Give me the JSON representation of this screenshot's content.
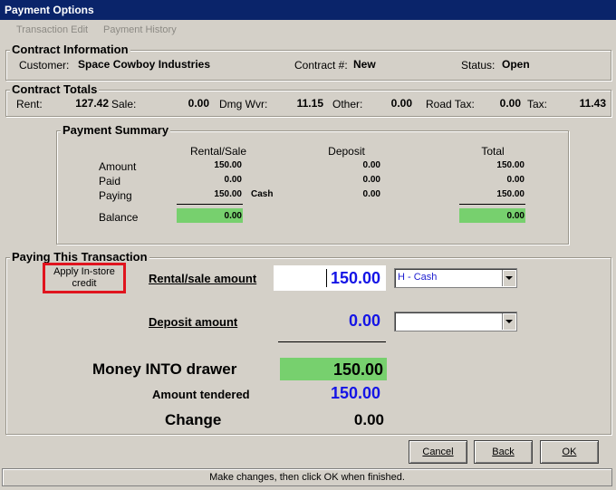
{
  "window": {
    "title": "Payment Options"
  },
  "menu": {
    "transaction_edit": "Transaction Edit",
    "payment_history": "Payment History"
  },
  "contract_info": {
    "legend": "Contract Information",
    "customer_label": "Customer:",
    "customer_value": "Space Cowboy Industries",
    "contract_label": "Contract #:",
    "contract_value": "New",
    "status_label": "Status:",
    "status_value": "Open"
  },
  "contract_totals": {
    "legend": "Contract Totals",
    "rent_label": "Rent:",
    "rent_value": "127.42",
    "sale_label": "Sale:",
    "sale_value": "0.00",
    "dmg_label": "Dmg Wvr:",
    "dmg_value": "11.15",
    "other_label": "Other:",
    "other_value": "0.00",
    "road_label": "Road Tax:",
    "road_value": "0.00",
    "tax_label": "Tax:",
    "tax_value": "11.43"
  },
  "payment_summary": {
    "legend": "Payment Summary",
    "col_rental": "Rental/Sale",
    "col_deposit": "Deposit",
    "col_total": "Total",
    "row_amount": "Amount",
    "row_paid": "Paid",
    "row_paying": "Paying",
    "row_balance": "Balance",
    "rental": {
      "amount": "150.00",
      "paid": "0.00",
      "paying": "150.00",
      "balance": "0.00"
    },
    "paying_method": "Cash",
    "deposit": {
      "amount": "0.00",
      "paid": "0.00",
      "paying": "0.00"
    },
    "total": {
      "amount": "150.00",
      "paid": "0.00",
      "paying": "150.00",
      "balance": "0.00"
    }
  },
  "paying": {
    "legend": "Paying This Transaction",
    "apply_credit": "Apply In-store credit",
    "rental_label": "Rental/sale amount",
    "rental_value": "150.00",
    "rental_method": "H - Cash",
    "deposit_label": "Deposit amount",
    "deposit_value": "0.00",
    "deposit_method": "",
    "money_into_label": "Money INTO drawer",
    "money_into_value": "150.00",
    "tendered_label": "Amount tendered",
    "tendered_value": "150.00",
    "change_label": "Change",
    "change_value": "0.00"
  },
  "buttons": {
    "cancel": "Cancel",
    "back": "Back",
    "ok": "OK"
  },
  "status_bar": "Make changes, then click OK when finished.",
  "colors": {
    "titlebar": "#0a246a",
    "balance_green": "#77d06e",
    "highlight_red": "#e0141e",
    "value_blue": "#1414e6"
  }
}
